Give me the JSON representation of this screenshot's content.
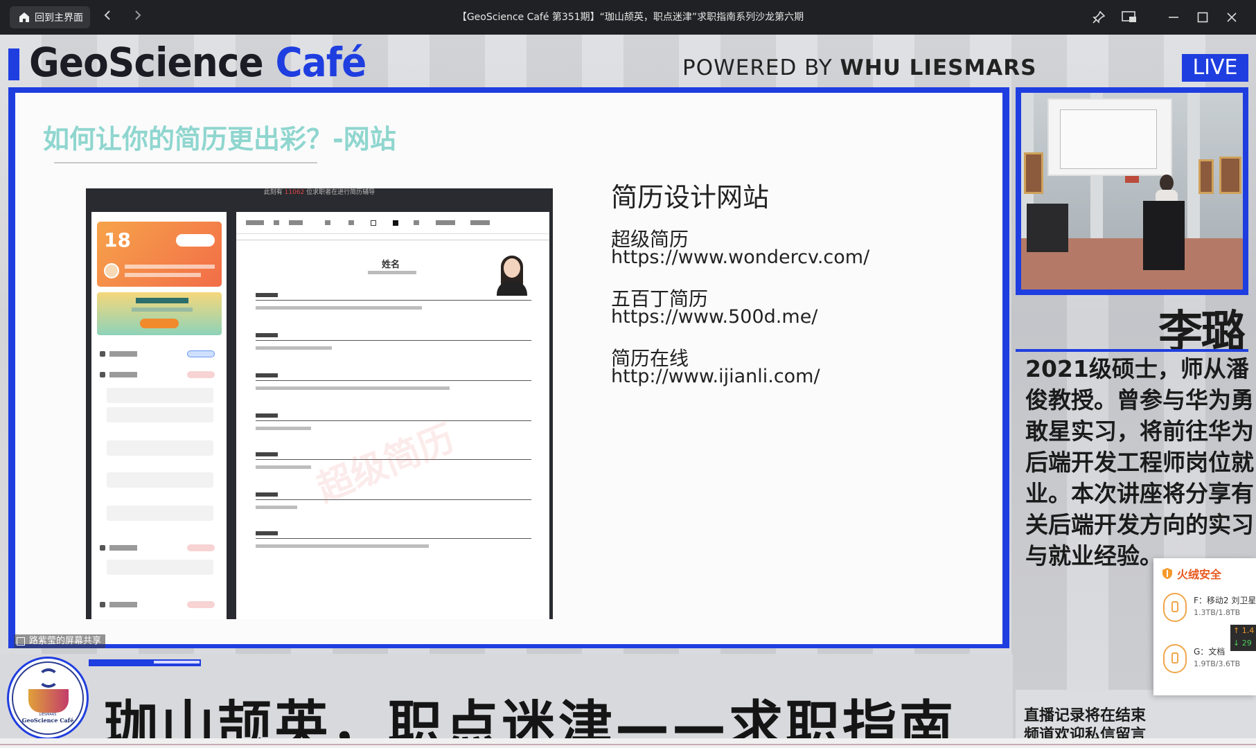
{
  "titlebar": {
    "home_label": "回到主界面",
    "back_icon": "chevron-left-icon",
    "forward_icon": "chevron-right-icon",
    "title": "【GeoScience Café 第351期】“珈山颉英，职点迷津”求职指南系列沙龙第六期",
    "buttons": [
      "pin-icon",
      "picture-in-picture-icon",
      "minimize-icon",
      "maximize-icon",
      "close-icon"
    ]
  },
  "stream": {
    "brand_main": "GeoScience ",
    "brand_accent": "Café",
    "powered_prefix": "POWERED BY ",
    "powered_bold": "WHU LIESMARS",
    "live_badge": "LIVE",
    "accent_color": "#1f3ee0"
  },
  "slide": {
    "title": "如何让你的简历更出彩？-网站",
    "title_color": "#8fd6cf",
    "screenshot": {
      "top_prefix": "此刻有 ",
      "top_count": "11062",
      "top_suffix": " 位求职者在进行简历辅导",
      "promo_count": "18",
      "resume_name": "姓名",
      "watermark": "超级简历"
    },
    "heading": "简历设计网站",
    "sites": [
      {
        "name": "超级简历",
        "url": "https://www.wondercv.com/"
      },
      {
        "name": "五百丁简历",
        "url": "https://www.500d.me/"
      },
      {
        "name": "简历在线",
        "url": "http://www.ijianli.com/"
      }
    ]
  },
  "share_label": "路紫莹的屏幕共享",
  "speaker": {
    "name": "李璐",
    "bio": "2021级硕士，师从潘俊教授。曾参与华为勇敢星实习，将前往华为后端开发工程师岗位就业。本次讲座将分享有关后端开发方向的实习与就业经验。"
  },
  "banner": {
    "logo_top": "LIESMARS",
    "logo_name": "GeoScience Café",
    "text": "珈山颉英，职点迷津——求职指南"
  },
  "notice": "直播记录将在结束频道欢迎私信留言哦~",
  "security_popup": {
    "title": "火绒安全",
    "drives": [
      {
        "label": "F：移动2 刘卫星",
        "size": "1.3TB/1.8TB"
      },
      {
        "label": "G：文档",
        "size": "1.9TB/3.6TB"
      }
    ],
    "speed_up": "↑ 1.4",
    "speed_down": "↓ 29"
  }
}
